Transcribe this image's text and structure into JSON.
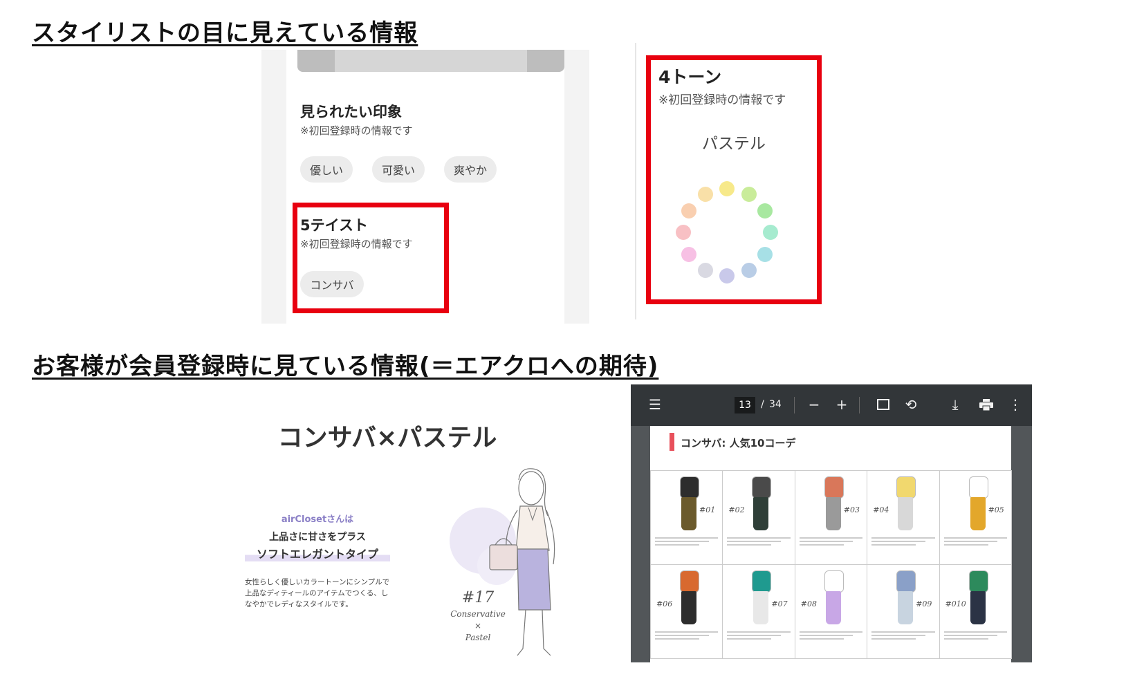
{
  "headings": {
    "top": "スタイリストの目に見えている情報",
    "bottom": "お客様が会員登録時に見ている情報(＝エアクロへの期待)"
  },
  "stylist_view": {
    "impression": {
      "title": "見られたい印象",
      "note": "※初回登録時の情報です",
      "chips": [
        "優しい",
        "可愛い",
        "爽やか"
      ]
    },
    "taste": {
      "title": "5テイスト",
      "note": "※初回登録時の情報です",
      "chips": [
        "コンサバ"
      ]
    },
    "tone": {
      "title": "4トーン",
      "note": "※初回登録時の情報です",
      "value": "パステル",
      "palette": [
        "#f7e98a",
        "#c9ec9a",
        "#a8e8a0",
        "#a6ebcf",
        "#a7e0e6",
        "#b9cde6",
        "#c9c9ea",
        "#d9d9e2",
        "#f7c0e4",
        "#f8c0c4",
        "#f9cfb0",
        "#f9e0a8"
      ]
    }
  },
  "customer_view": {
    "result_title": "コンサバ×パステル",
    "brand_line": "airClosetさんは",
    "tagline": "上品さに甘さをプラス",
    "type_name": "ソフトエレガントタイプ",
    "description": [
      "女性らしく優しいカラートーンにシンプルで",
      "上品なディティールのアイテムでつくる、し",
      "なやかでレディなスタイルです。"
    ],
    "type_number": "#17",
    "type_words": [
      "Conservative",
      "×",
      "Pastel"
    ]
  },
  "pdf_viewer": {
    "page_current": "13",
    "page_separator": "/",
    "page_total": "34",
    "section_title": "コンサバ: 人気10コーデ",
    "accent_color": "#e8505b",
    "outfit_labels": [
      "#01",
      "#02",
      "#03",
      "#04",
      "#05",
      "#06",
      "#07",
      "#08",
      "#09",
      "#010"
    ],
    "icons": [
      "menu-icon",
      "zoom-out-icon",
      "zoom-in-icon",
      "fit-page-icon",
      "rotate-icon",
      "download-icon",
      "print-icon",
      "more-icon"
    ]
  }
}
